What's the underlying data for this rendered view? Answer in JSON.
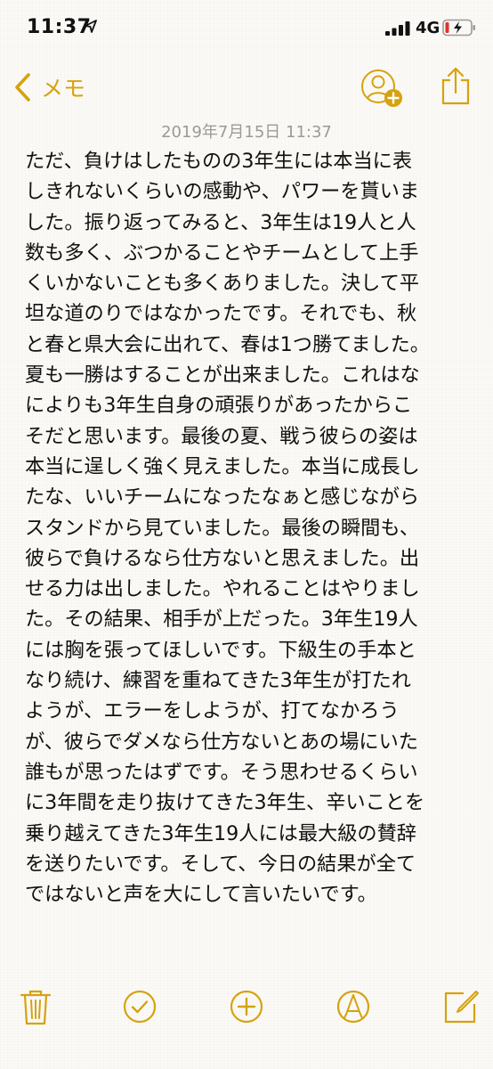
{
  "status_bar": {
    "time": "11:37",
    "network": "4G",
    "icons": [
      "location-arrow-icon",
      "cellular-signal-icon",
      "battery-charging-icon"
    ]
  },
  "nav": {
    "back_label": "メモ",
    "icons": [
      "chevron-left-icon",
      "add-people-icon",
      "share-icon"
    ],
    "accent_color": "#d6a20f"
  },
  "note": {
    "date": "2019年7月15日 11:37",
    "lines": [
      "ただ、負けはしたものの3年生には本当に表",
      "しきれないくらいの感動や、パワーを貰いま",
      "した。振り返ってみると、3年生は19人と人",
      "数も多く、ぶつかることやチームとして上手",
      "くいかないことも多くありました。決して平",
      "坦な道のりではなかったです。それでも、秋",
      "と春と県大会に出れて、春は1つ勝てました。",
      "夏も一勝はすることが出来ました。これはな",
      "によりも3年生自身の頑張りがあったからこ",
      "そだと思います。最後の夏、戦う彼らの姿は",
      "本当に逞しく強く見えました。本当に成長し",
      "たな、いいチームになったなぁと感じながら",
      "スタンドから見ていました。最後の瞬間も、",
      "彼らで負けるなら仕方ないと思えました。出",
      "せる力は出しました。やれることはやりまし",
      "た。その結果、相手が上だった。3年生19人",
      "には胸を張ってほしいです。下級生の手本と",
      "なり続け、練習を重ねてきた3年生が打たれ",
      "ようが、エラーをしようが、打てなかろう",
      "が、彼らでダメなら仕方ないとあの場にいた",
      "誰もが思ったはずです。そう思わせるくらい",
      "に3年間を走り抜けてきた3年生、辛いことを",
      "乗り越えてきた3年生19人には最大級の賛辞",
      "を送りたいです。そして、今日の結果が全て",
      "ではないと声を大にして言いたいです。"
    ]
  },
  "toolbar": {
    "icons": [
      "trash-icon",
      "checklist-icon",
      "add-icon",
      "markup-icon",
      "compose-icon"
    ]
  }
}
